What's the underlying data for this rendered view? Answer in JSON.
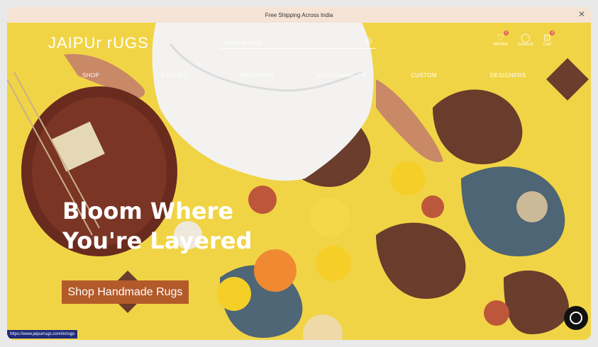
{
  "announcement": {
    "text": "Free Shipping Across India"
  },
  "logo": {
    "text": "JAIPUr rUGS"
  },
  "search": {
    "placeholder": "search our rugs"
  },
  "header": {
    "wishlist_label": "Wishlist",
    "account_label": "Account",
    "cart_label": "Cart",
    "wishlist_count": "0",
    "cart_count": "0"
  },
  "nav": {
    "items": [
      "SHOP",
      "STORIES",
      "MANCHAHA",
      "SUSTAINABILITY",
      "CUSTOM",
      "DESIGNERS"
    ]
  },
  "hero": {
    "line1": "Bloom Where",
    "line2": "You're Layered",
    "cta": "Shop Handmade Rugs"
  },
  "status_url": "https://www.jaipurrugs.com/in/rugs",
  "colors": {
    "announcement_bg": "#f5e3d5",
    "cta_bg": "#b35a2a",
    "rug_yellow": "#f2d84a",
    "status_bar": "#1f2a7a"
  }
}
